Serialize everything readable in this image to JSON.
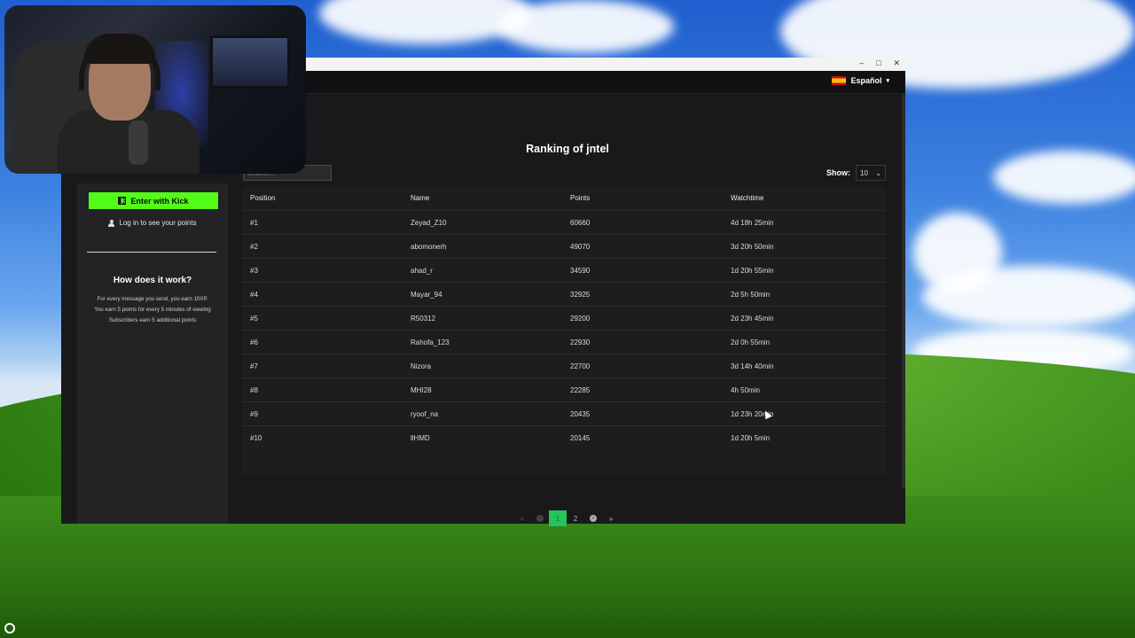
{
  "header": {
    "language": "Español"
  },
  "sidebar": {
    "kick_button": "Enter with Kick",
    "login_link": "Log in to see your points",
    "how_title": "How does it work?",
    "how_lines": [
      "For every message you send, you earn 10XP.",
      "You earn 5 points for every 5 minutes of viewing",
      "Subscribers earn 5 additional points"
    ]
  },
  "main": {
    "title": "Ranking of jntel",
    "search_placeholder": "Search...",
    "show_label": "Show:",
    "show_value": "10",
    "columns": [
      "Position",
      "Name",
      "Points",
      "Watchtime"
    ],
    "rows": [
      [
        "#1",
        "Zeyad_Z10",
        "60660",
        "4d 18h 25min"
      ],
      [
        "#2",
        "abomonerh",
        "49070",
        "3d 20h 50min"
      ],
      [
        "#3",
        "ahad_r",
        "34590",
        "1d 20h 55min"
      ],
      [
        "#4",
        "Mayar_94",
        "32925",
        "2d 5h 50min"
      ],
      [
        "#5",
        "R50312",
        "29200",
        "2d 23h 45min"
      ],
      [
        "#6",
        "Rahofa_123",
        "22930",
        "2d 0h 55min"
      ],
      [
        "#7",
        "Nizora",
        "22700",
        "3d 14h 40min"
      ],
      [
        "#8",
        "MHI28",
        "22285",
        "4h 50min"
      ],
      [
        "#9",
        "ryoof_na",
        "20435",
        "1d 23h 20min"
      ],
      [
        "#10",
        "llHMD",
        "20145",
        "1d 20h 5min"
      ]
    ],
    "pagination": {
      "first": "«",
      "prev": "‹",
      "pages": [
        "1",
        "2"
      ],
      "current": "1",
      "next": "›",
      "last": "»"
    }
  },
  "window": {
    "controls": [
      "–",
      "□",
      "✕"
    ]
  },
  "colors": {
    "accent": "#53fc18",
    "page_active": "#22c55e",
    "background": "#19191b",
    "panel": "#232325"
  }
}
